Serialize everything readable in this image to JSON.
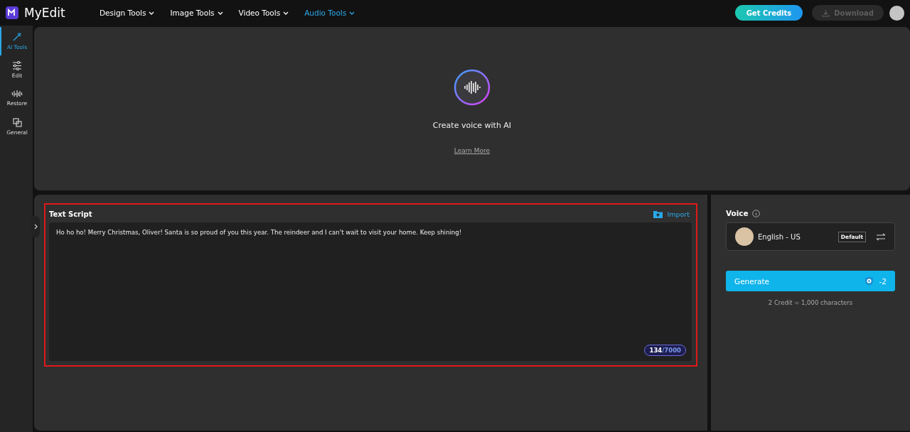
{
  "app": {
    "name": "MyEdit"
  },
  "nav": [
    {
      "label": "Design Tools",
      "selected": false
    },
    {
      "label": "Image Tools",
      "selected": false
    },
    {
      "label": "Video Tools",
      "selected": false
    },
    {
      "label": "Audio Tools",
      "selected": true
    }
  ],
  "header_buttons": {
    "credits": "Get Credits",
    "download": "Download",
    "download_disabled": true
  },
  "sidebar": [
    {
      "label": "AI Tools",
      "selected": true
    },
    {
      "label": "Edit",
      "selected": false
    },
    {
      "label": "Restore",
      "selected": false
    },
    {
      "label": "General",
      "selected": false
    }
  ],
  "hero": {
    "title": "Create voice with AI",
    "link": "Learn More"
  },
  "script": {
    "title": "Text Script",
    "import": "Import",
    "value": "Ho ho ho! Merry Christmas, Oliver! Santa is so proud of you this year. The reindeer and I can't wait to visit your home. Keep shining!",
    "count": "134",
    "limit": "/7000",
    "highlighted": true
  },
  "voice": {
    "label": "Voice",
    "name": "English - US",
    "badge": "Default"
  },
  "generate": {
    "label": "Generate",
    "cost": "-2",
    "note": "2 Credit = 1,000 characters"
  }
}
